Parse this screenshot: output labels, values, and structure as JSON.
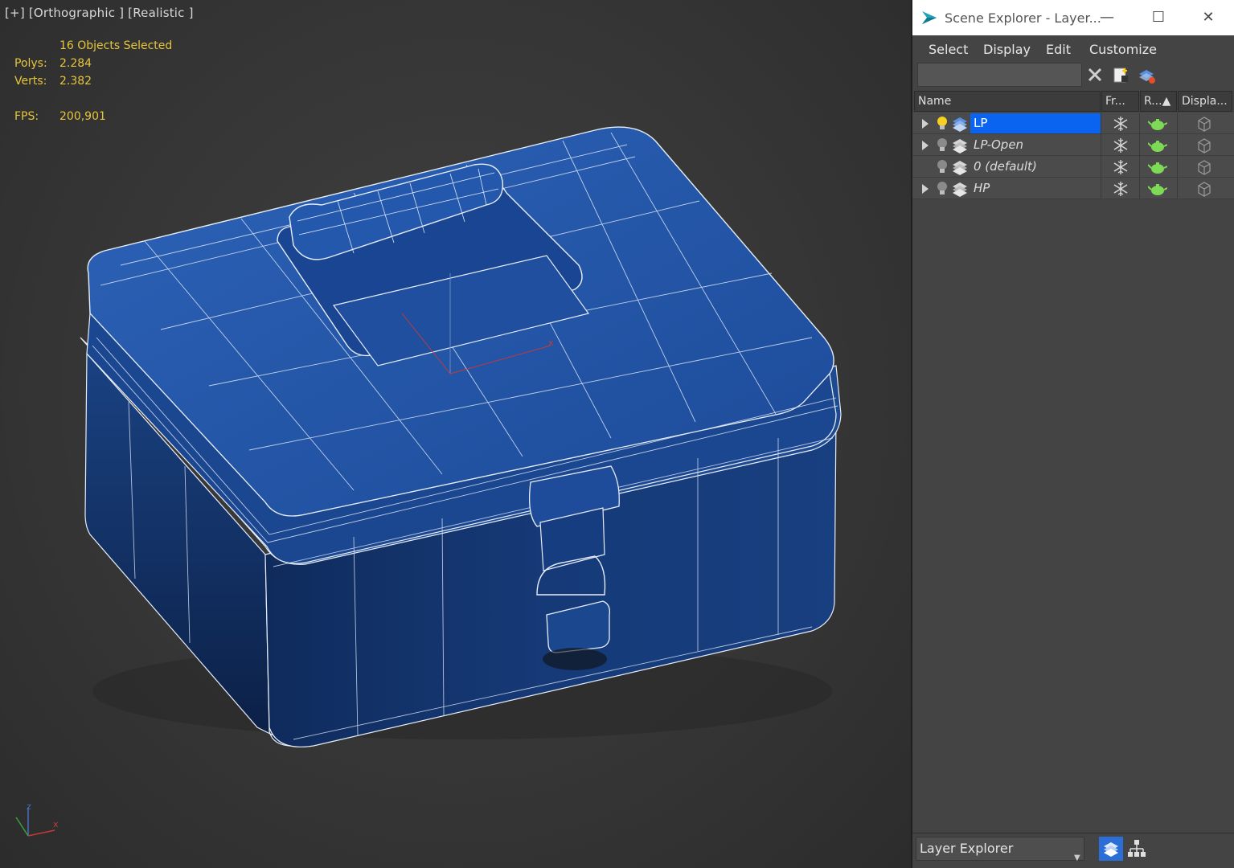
{
  "viewport": {
    "label": "[+] [Orthographic ] [Realistic ]",
    "selection_text": "16 Objects Selected",
    "polys_label": "Polys:",
    "polys_value": "2.284",
    "verts_label": "Verts:",
    "verts_value": "2.382",
    "fps_label": "FPS:",
    "fps_value": "200,901",
    "gizmo_x": "x",
    "axis_z": "z",
    "axis_x": "x",
    "model_color": "#1e4e9c"
  },
  "panel": {
    "title": "Scene Explorer - Layer...",
    "menu": [
      "Select",
      "Display",
      "Edit",
      "Customize"
    ],
    "search_value": "",
    "columns": [
      "Name",
      "Fr...",
      "R...▲",
      "Displa..."
    ],
    "layers": [
      {
        "name": "LP",
        "selected": true,
        "expandable": true,
        "active": true
      },
      {
        "name": "LP-Open",
        "selected": false,
        "expandable": true,
        "active": false
      },
      {
        "name": "0 (default)",
        "selected": false,
        "expandable": false,
        "active": false
      },
      {
        "name": "HP",
        "selected": false,
        "expandable": true,
        "active": false
      }
    ],
    "explorer_dropdown": "Layer Explorer",
    "selection_color": "#0a64f0"
  }
}
